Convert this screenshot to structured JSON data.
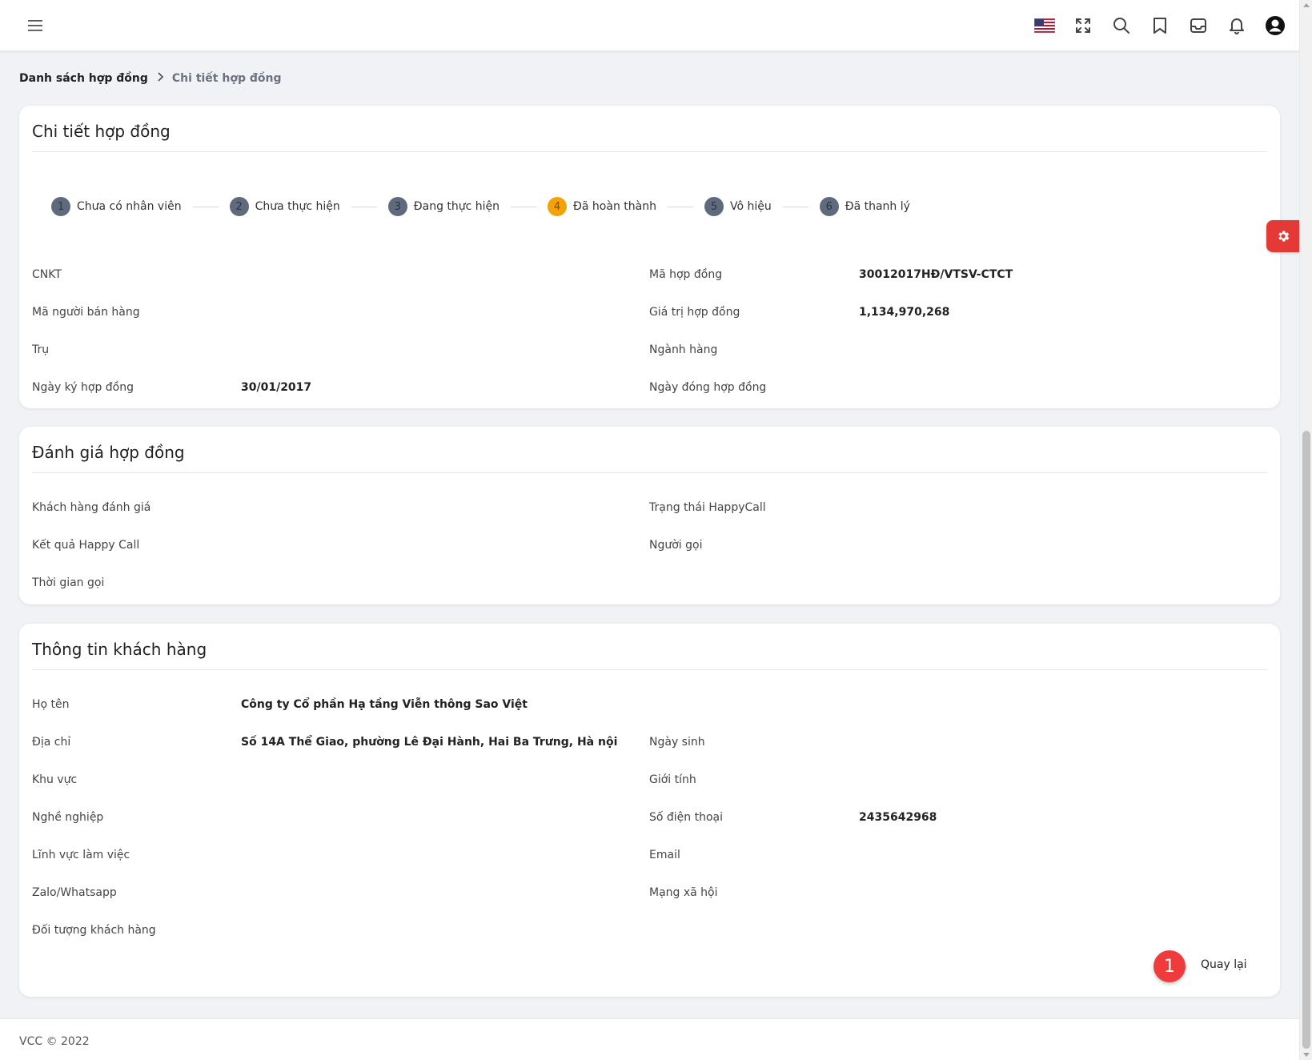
{
  "breadcrumb": {
    "parent": "Danh sách hợp đồng",
    "current": "Chi tiết hợp đồng"
  },
  "contract": {
    "title": "Chi tiết hợp đồng",
    "steps": [
      {
        "num": "1",
        "label": "Chưa có nhân viên",
        "active": false
      },
      {
        "num": "2",
        "label": "Chưa thực hiện",
        "active": false
      },
      {
        "num": "3",
        "label": "Đang thực hiện",
        "active": false
      },
      {
        "num": "4",
        "label": "Đã hoàn thành",
        "active": true
      },
      {
        "num": "5",
        "label": "Vô hiệu",
        "active": false
      },
      {
        "num": "6",
        "label": "Đã thanh lý",
        "active": false
      }
    ],
    "fields": {
      "cnkt_label": "CNKT",
      "cnkt_value": "",
      "contract_code_label": "Mã hợp đồng",
      "contract_code_value": "30012017HĐ/VTSV-CTCT",
      "seller_code_label": "Mã người bán hàng",
      "seller_code_value": "",
      "contract_value_label": "Giá trị hợp đồng",
      "contract_value_value": "1,134,970,268",
      "tru_label": "Trụ",
      "tru_value": "",
      "industry_label": "Ngành hàng",
      "industry_value": "",
      "sign_date_label": "Ngày ký hợp đồng",
      "sign_date_value": "30/01/2017",
      "close_date_label": "Ngày đóng hợp đồng",
      "close_date_value": ""
    }
  },
  "evaluation": {
    "title": "Đánh giá hợp đồng",
    "fields": {
      "customer_rating_label": "Khách hàng đánh giá",
      "happycall_status_label": "Trạng thái HappyCall",
      "happycall_result_label": "Kết quả Happy Call",
      "caller_label": "Người gọi",
      "call_time_label": "Thời gian gọi"
    }
  },
  "customer": {
    "title": "Thông tin khách hàng",
    "fields": {
      "name_label": "Họ tên",
      "name_value": "Công ty Cổ phần Hạ tầng Viễn thông Sao Việt",
      "address_label": "Địa chỉ",
      "address_value": "Số 14A Thể Giao, phường Lê Đại Hành, Hai Ba Trưng, Hà nội",
      "dob_label": "Ngày sinh",
      "region_label": "Khu vực",
      "gender_label": "Giới tính",
      "job_label": "Nghề nghiệp",
      "phone_label": "Số điện thoại",
      "phone_value": "2435642968",
      "work_field_label": "Lĩnh vực làm việc",
      "email_label": "Email",
      "zalo_label": "Zalo/Whatsapp",
      "social_label": "Mạng xã hội",
      "customer_type_label": "Đối tượng khách hàng"
    }
  },
  "actions": {
    "badge": "1",
    "back_label": "Quay lại"
  },
  "footer": {
    "text": "VCC © 2022"
  },
  "colors": {
    "accent": "#f5a20a",
    "step": "#5f6b7d",
    "danger": "#e53935"
  },
  "icons": [
    "menu-icon",
    "us-flag-icon",
    "fullscreen-icon",
    "search-icon",
    "bookmark-icon",
    "inbox-icon",
    "bell-icon",
    "user-avatar-icon",
    "gear-icon",
    "chevron-right-icon"
  ]
}
